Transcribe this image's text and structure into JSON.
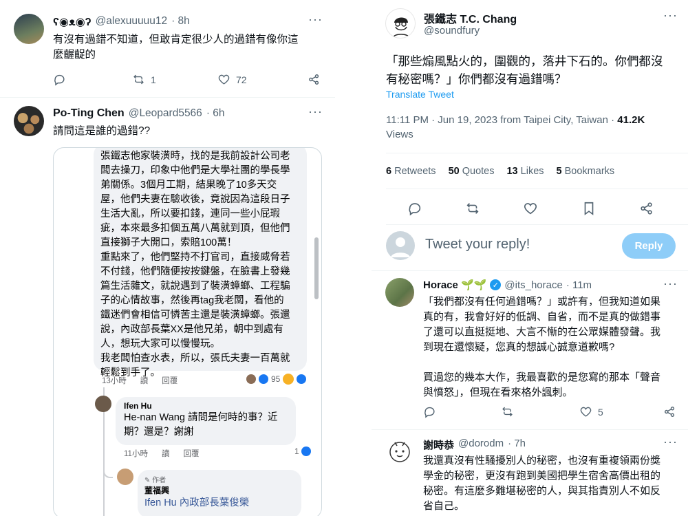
{
  "left": {
    "tweet1": {
      "name": "ʕ◉ᴥ◉ʔ",
      "handle": "@alexuuuuu12",
      "time": "· 8h",
      "text_line1": "有沒有過錯不知道，但敢肯定很少人的過錯有像你這",
      "text_line2": "麼齷齪的",
      "retweets": "1",
      "likes": "72"
    },
    "tweet2": {
      "name": "Po-Ting Chen",
      "handle": "@Leopard5566",
      "time": "· 6h",
      "text": "請問這是誰的過錯??"
    },
    "fb": {
      "post_lines": [
        "張鐵志他家裝潢時，找的是我前設計公司老",
        "闆去操刀，印象中他們是大學社團的學長學",
        "弟關係。3個月工期，結果晚了10多天交",
        "屋，他們夫妻在驗收後，竟說因為這段日子",
        "生活大亂，所以要扣錢，連同一些小屁瑕",
        "疵，本來最多扣個五萬八萬就到頂，但他們",
        "直接獅子大開口，索賠100萬！",
        "重點來了，他們堅持不打官司，直接威脅若",
        "不付錢，他們隨便按按鍵盤，在臉書上發幾",
        "篇生活雜文，就說遇到了裝潢蟑螂、工程騙",
        "子的心情故事，然後再tag我老闆，看他的",
        "鐵迷們會相信可憐苦主還是裝潢蟑螂。張還",
        "說，內政部長葉XX是他兄弟，朝中到處有",
        "人，想玩大家可以慢慢玩。",
        "我老闆怕查水表，所以，張氏夫妻一百萬就",
        "輕鬆到手了。"
      ],
      "meta1_time": "13小時",
      "meta1_read": "讀",
      "meta1_reply": "回覆",
      "reaction_count": "95",
      "reply_name": "Ifen Hu",
      "reply_line1": "He-nan Wang 請問是何時的事？近",
      "reply_line2": "期？還是？謝謝",
      "meta2_time": "11小時",
      "meta2_read": "讀",
      "meta2_reply": "回覆",
      "meta2_reactions": "1",
      "author_badge": "作者",
      "author_name": "董福興",
      "author_text": "Ifen Hu 內政部長葉俊榮"
    }
  },
  "right": {
    "main": {
      "name": "張鐵志 T.C. Chang",
      "handle": "@soundfury",
      "text_line1": "「那些煽風點火的，圍觀的，落井下石的。你們都沒",
      "text_line2": "有秘密嗎？」你們都沒有過錯嗎？",
      "translate": "Translate Tweet",
      "meta": "11:11 PM · Jun 19, 2023 from Taipei City, Taiwan · ",
      "views_count": "41.2K",
      "views_label": "Views",
      "retweets_n": "6",
      "retweets_l": "Retweets",
      "quotes_n": "50",
      "quotes_l": "Quotes",
      "likes_n": "13",
      "likes_l": "Likes",
      "bookmarks_n": "5",
      "bookmarks_l": "Bookmarks"
    },
    "reply_box": {
      "placeholder": "Tweet your reply!",
      "button": "Reply"
    },
    "horace": {
      "name": "Horace 🌱🌱",
      "handle": "@its_horace",
      "time": "· 11m",
      "lines": [
        "「我們都沒有任何過錯嗎？」或許有，但我知道如果",
        "真的有，我會好好的低調、自省，而不是真的做錯事",
        "了還可以直挺挺地、大言不慚的在公眾媒體發聲。我",
        "到現在還懷疑，您真的想誠心誠意道歉嗎?"
      ],
      "lines2": [
        "買過您的幾本大作，我最喜歡的是您寫的那本「聲音",
        "與憤怒」，但現在看來格外諷刺。"
      ],
      "likes": "5"
    },
    "tweet3": {
      "name": "謝時恭",
      "handle": "@dorodm",
      "time": "· 7h",
      "lines": [
        "我還真沒有性騷擾別人的秘密，也沒有重複領兩份獎",
        "學金的秘密，更沒有跑到美國把學生宿舍高價出租的",
        "秘密。有這麼多難堪秘密的人，與其指責別人不如反",
        "省自己。"
      ]
    }
  },
  "colors": {
    "twitter_blue": "#1d9bf0",
    "reply_button": "#8ecdf8",
    "fb_bubble": "#f0f2f5"
  }
}
